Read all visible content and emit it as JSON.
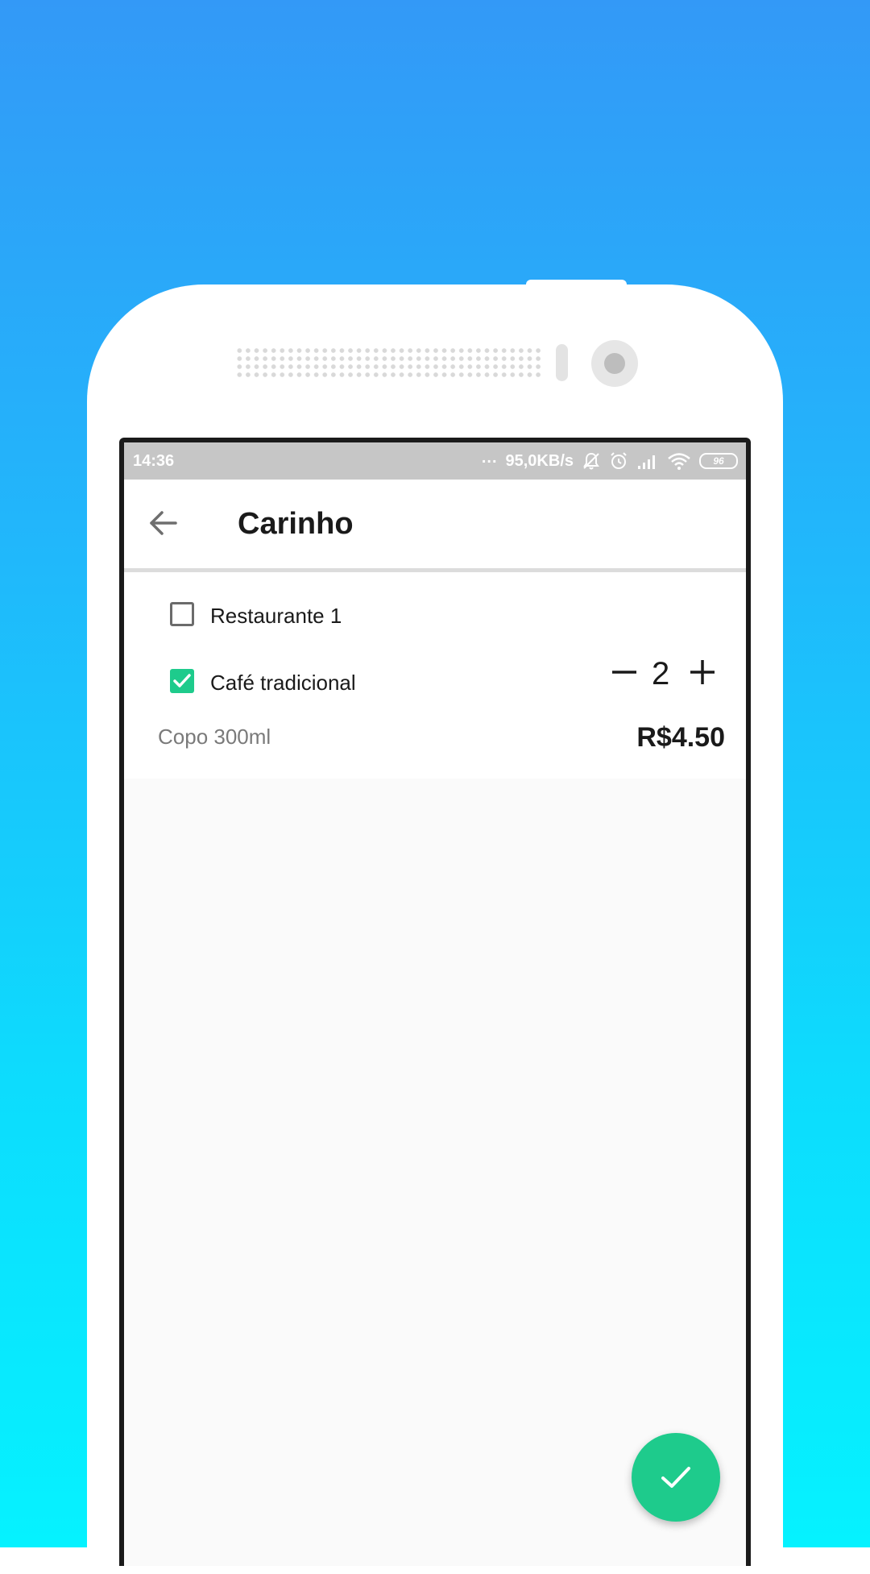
{
  "status_bar": {
    "time": "14:36",
    "dots": "...",
    "network_speed": "95,0KB/s",
    "battery": "96",
    "icons": [
      "bell-off-icon",
      "alarm-icon",
      "signal-icon",
      "wifi-icon",
      "battery-icon"
    ]
  },
  "appbar": {
    "title": "Carinho",
    "back_icon": "arrow-left-icon"
  },
  "cart": {
    "restaurant": {
      "label": "Restaurante 1",
      "checked": false
    },
    "items": [
      {
        "name": "Café tradicional",
        "checked": true,
        "quantity": "2",
        "description": "Copo 300ml",
        "price": "R$4.50"
      }
    ]
  },
  "fab": {
    "icon": "check-icon"
  },
  "colors": {
    "accent": "#1ecb8c",
    "background_top": "#3399f7",
    "background_bottom": "#05f2ff",
    "status_bar": "#c6c6c6"
  }
}
